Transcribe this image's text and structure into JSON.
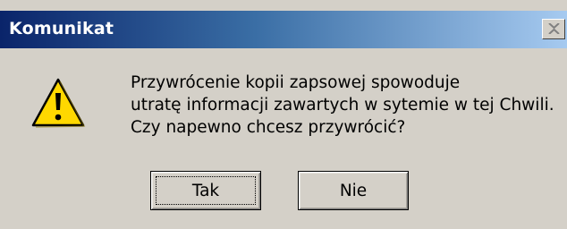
{
  "dialog": {
    "title": "Komunikat",
    "icon": "warning-icon",
    "message_lines": [
      "Przywrócenie kopii zapsowej spowoduje",
      "utratę informacji zawartych w sytemie w tej Chwili.",
      "Czy napewno chcesz przywrócić?"
    ],
    "buttons": {
      "yes_label": "Tak",
      "no_label": "Nie"
    }
  },
  "colors": {
    "titlebar_start": "#0a246a",
    "titlebar_end": "#a6caf0",
    "face": "#d4d0c8",
    "warning_fill": "#ffd800"
  }
}
